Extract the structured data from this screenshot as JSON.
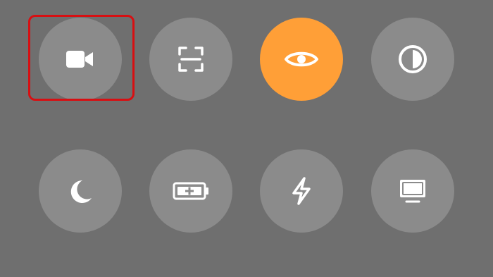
{
  "control_center": {
    "row1": [
      {
        "name": "screen-recording",
        "icon": "video-camera-icon",
        "active": false
      },
      {
        "name": "code-scanner",
        "icon": "qr-scan-icon",
        "active": false
      },
      {
        "name": "eye-comfort",
        "icon": "eye-icon",
        "active": true
      },
      {
        "name": "dark-mode",
        "icon": "contrast-icon",
        "active": false
      }
    ],
    "row2": [
      {
        "name": "night-mode",
        "icon": "moon-icon",
        "active": false
      },
      {
        "name": "battery-saver",
        "icon": "battery-plus-icon",
        "active": false
      },
      {
        "name": "flash",
        "icon": "lightning-icon",
        "active": false
      },
      {
        "name": "screen-mirroring",
        "icon": "monitor-icon",
        "active": false
      }
    ],
    "highlight_target": "screen-recording"
  },
  "colors": {
    "background": "#6f6f6f",
    "tile": "#8b8b8b",
    "active_tile": "#ff9f37",
    "icon": "#ffffff",
    "highlight": "#d80f12"
  }
}
